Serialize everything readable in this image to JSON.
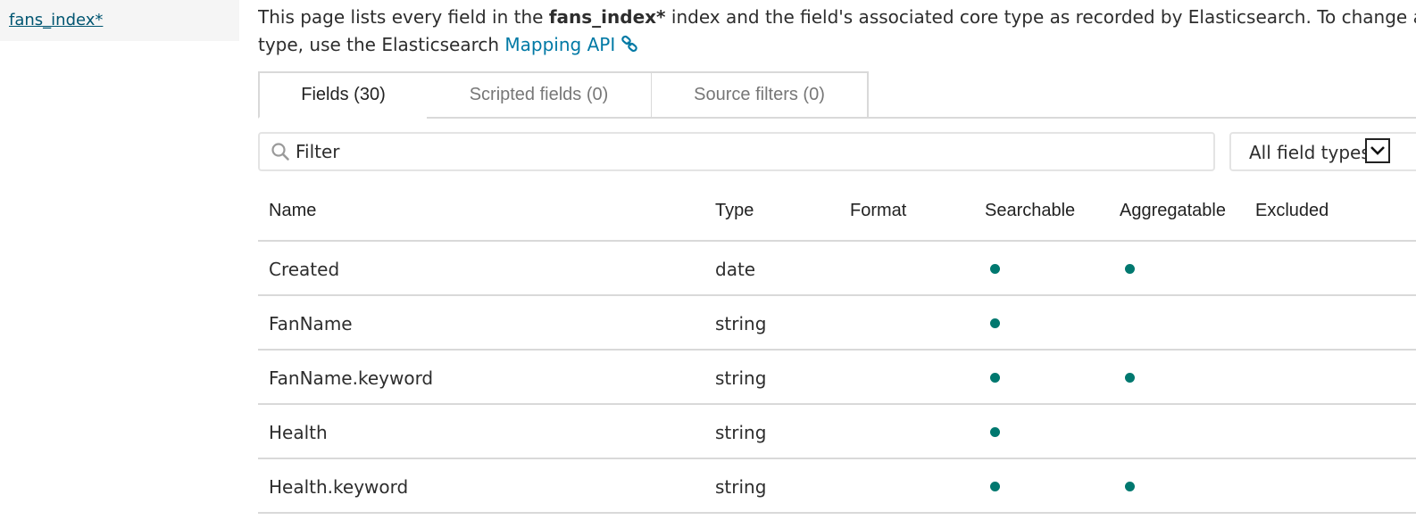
{
  "sidebar": {
    "index_link": "fans_index*"
  },
  "intro": {
    "text_before": "This page lists every field in the ",
    "index_name": "fans_index*",
    "text_after": " index and the field's associated core type as recorded by Elasticsearch. To change a field",
    "line2_text": "type, use the Elasticsearch ",
    "api_link": "Mapping API",
    "link_icon": "link-icon"
  },
  "tabs": [
    {
      "label": "Fields (30)",
      "active": true
    },
    {
      "label": "Scripted fields (0)",
      "active": false
    },
    {
      "label": "Source filters (0)",
      "active": false
    }
  ],
  "filter": {
    "placeholder": "Filter",
    "icon": "search-icon"
  },
  "type_select": {
    "selected": "All field types",
    "icon": "chevron-down-icon"
  },
  "table": {
    "headers": {
      "name": "Name",
      "type": "Type",
      "format": "Format",
      "searchable": "Searchable",
      "aggregatable": "Aggregatable",
      "excluded": "Excluded"
    },
    "rows": [
      {
        "name": "Created",
        "type": "date",
        "format": "",
        "searchable": true,
        "aggregatable": true,
        "excluded": false
      },
      {
        "name": "FanName",
        "type": "string",
        "format": "",
        "searchable": true,
        "aggregatable": false,
        "excluded": false
      },
      {
        "name": "FanName.keyword",
        "type": "string",
        "format": "",
        "searchable": true,
        "aggregatable": true,
        "excluded": false
      },
      {
        "name": "Health",
        "type": "string",
        "format": "",
        "searchable": true,
        "aggregatable": false,
        "excluded": false
      },
      {
        "name": "Health.keyword",
        "type": "string",
        "format": "",
        "searchable": true,
        "aggregatable": true,
        "excluded": false
      }
    ]
  },
  "colors": {
    "link": "#0079a5",
    "sidebar_link": "#005571",
    "dot": "#00786f",
    "border": "#d9d9d9"
  }
}
